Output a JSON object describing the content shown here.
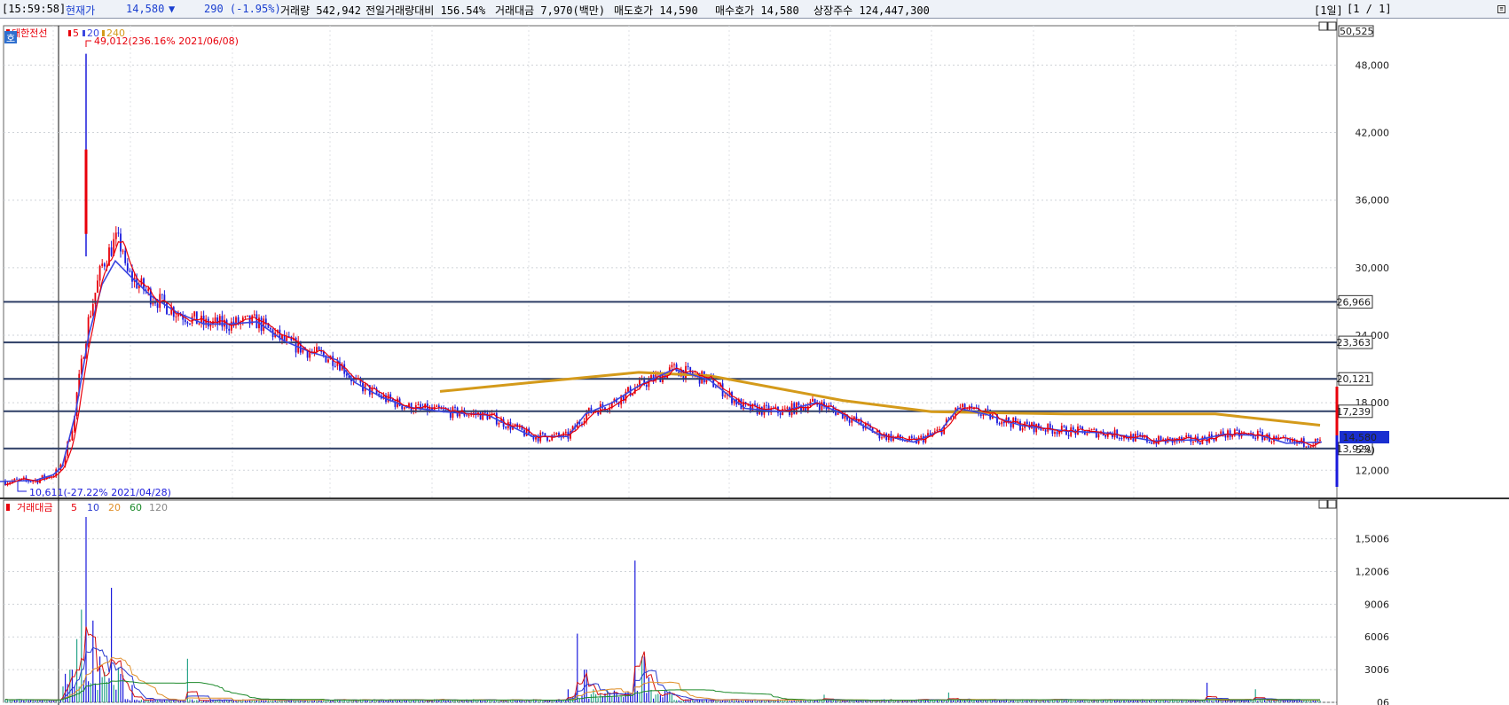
{
  "header": {
    "time": "[15:59:58]",
    "price_label": "현재가",
    "price": "14,580",
    "arrow": "▼",
    "change": "290 (-1.95%)",
    "volume": "거래량 542,942",
    "vol_ratio": "전일거래량대비 156.54%",
    "turnover": "거래대금 7,970(백만)",
    "ask": "매도호가 14,590",
    "bid": "매수호가 14,580",
    "shares": "상장주수 124,447,300",
    "period": "[1일]",
    "page": "[1 / 1]"
  },
  "price_panel": {
    "legend": {
      "name": "대한전선",
      "ma": [
        "5",
        "20",
        "240"
      ]
    },
    "max_label": "49,012(236.16% 2021/06/08)",
    "min_label": "10,611(-27.22% 2021/04/28)",
    "corner_badge": "호",
    "y_ticks": [
      "48,000",
      "42,000",
      "36,000",
      "30,000",
      "24,000",
      "18,000",
      "12,000"
    ],
    "top_value": "50,525",
    "levels": [
      {
        "label": "26,966",
        "value": 26966
      },
      {
        "label": "23,363",
        "value": 23363
      },
      {
        "label": "20,121",
        "value": 20121
      },
      {
        "label": "17,239",
        "value": 17239
      },
      {
        "label": "13,929",
        "value": 13929
      }
    ],
    "current_price": "14,580",
    "current_pct": "5%)"
  },
  "volume_panel": {
    "legend": {
      "name": "거래대금",
      "ma": [
        "5",
        "10",
        "20",
        "60",
        "120"
      ]
    },
    "y_ticks": [
      "1,5006",
      "1,2006",
      "9006",
      "6006",
      "3006",
      "06"
    ]
  },
  "colors": {
    "up": "#e8000b",
    "down": "#1a1adc",
    "ma5": "#e8000b",
    "ma20": "#3a46e0",
    "ma240": "#d49a1a",
    "level": "#2e3f66"
  },
  "chart_data": {
    "type": "line",
    "title": "대한전선",
    "y_range": [
      9500,
      51500
    ],
    "series": [
      {
        "name": "20",
        "points": [
          [
            0,
            11000
          ],
          [
            40,
            11100
          ],
          [
            60,
            11600
          ],
          [
            70,
            12300
          ],
          [
            85,
            17000
          ],
          [
            100,
            24000
          ],
          [
            115,
            28500
          ],
          [
            130,
            30600
          ],
          [
            150,
            29000
          ],
          [
            170,
            27500
          ],
          [
            200,
            26000
          ],
          [
            230,
            25000
          ],
          [
            260,
            25000
          ],
          [
            290,
            25200
          ],
          [
            320,
            23500
          ],
          [
            350,
            22500
          ],
          [
            380,
            21800
          ],
          [
            400,
            19800
          ],
          [
            430,
            18500
          ],
          [
            460,
            17600
          ],
          [
            500,
            17200
          ],
          [
            550,
            16900
          ],
          [
            600,
            15000
          ],
          [
            640,
            15000
          ],
          [
            660,
            17000
          ],
          [
            690,
            18000
          ],
          [
            720,
            19500
          ],
          [
            760,
            21000
          ],
          [
            800,
            20000
          ],
          [
            840,
            17500
          ],
          [
            880,
            17200
          ],
          [
            920,
            18000
          ],
          [
            950,
            17000
          ],
          [
            990,
            15200
          ],
          [
            1030,
            14500
          ],
          [
            1060,
            15500
          ],
          [
            1080,
            17500
          ],
          [
            1110,
            17000
          ],
          [
            1150,
            16000
          ],
          [
            1200,
            15500
          ],
          [
            1250,
            15300
          ],
          [
            1300,
            14600
          ],
          [
            1350,
            14700
          ],
          [
            1380,
            15200
          ],
          [
            1420,
            15100
          ],
          [
            1450,
            14400
          ],
          [
            1490,
            14500
          ]
        ]
      },
      {
        "name": "240",
        "points": [
          [
            496,
            19000
          ],
          [
            600,
            19800
          ],
          [
            720,
            20700
          ],
          [
            800,
            20400
          ],
          [
            950,
            18200
          ],
          [
            1050,
            17200
          ],
          [
            1200,
            17000
          ],
          [
            1370,
            17000
          ],
          [
            1488,
            16000
          ]
        ]
      }
    ],
    "volume": {
      "name": "거래대금",
      "y_range": [
        0,
        1700
      ],
      "y_ticks": [
        0,
        300,
        600,
        900,
        1200,
        1500
      ],
      "spikes": [
        [
          80,
          300
        ],
        [
          86,
          580
        ],
        [
          92,
          850
        ],
        [
          97,
          1700
        ],
        [
          104,
          750
        ],
        [
          112,
          420
        ],
        [
          118,
          280
        ],
        [
          125,
          1050
        ],
        [
          133,
          320
        ],
        [
          150,
          160
        ],
        [
          212,
          400
        ],
        [
          650,
          630
        ],
        [
          660,
          300
        ],
        [
          716,
          1300
        ],
        [
          725,
          420
        ],
        [
          732,
          230
        ],
        [
          930,
          70
        ],
        [
          1070,
          90
        ],
        [
          1360,
          180
        ],
        [
          1415,
          120
        ]
      ]
    }
  }
}
